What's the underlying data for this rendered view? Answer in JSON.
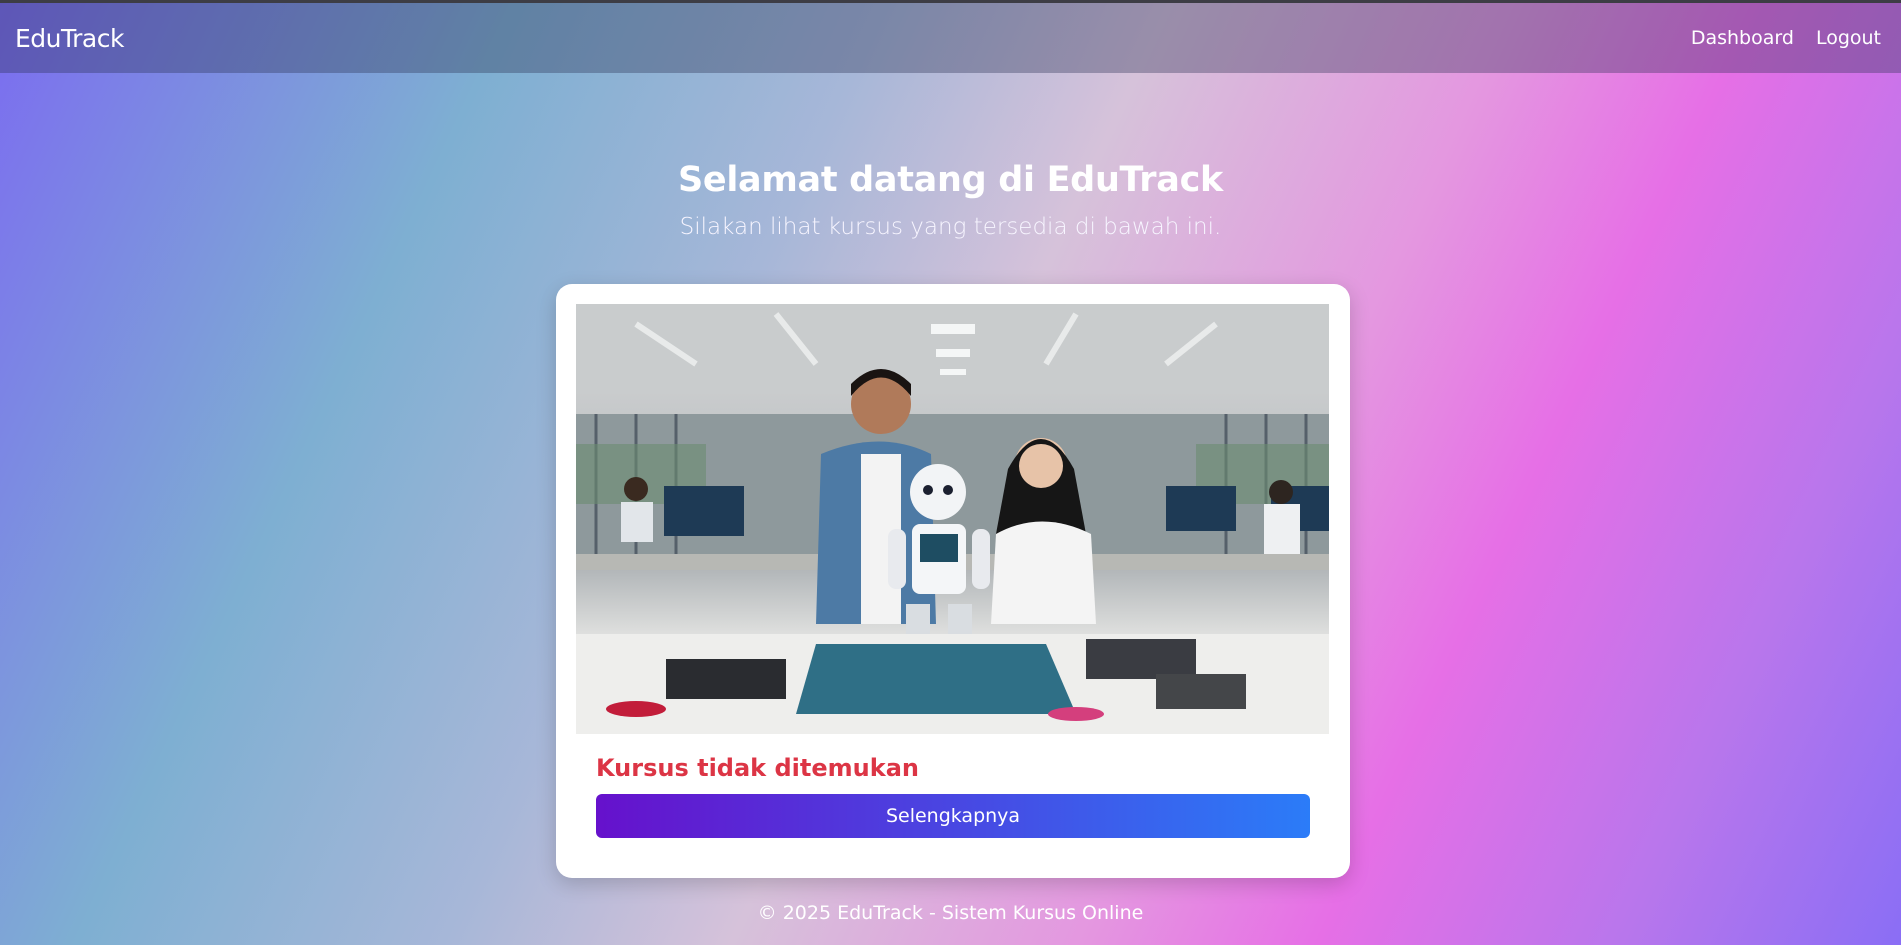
{
  "navbar": {
    "brand": "EduTrack",
    "links": [
      "Dashboard",
      "Logout"
    ]
  },
  "hero": {
    "title": "Selamat datang di EduTrack",
    "subtitle": "Silakan lihat kursus yang tersedia di bawah ini."
  },
  "course_card": {
    "image_name": "robotics-lab-photo",
    "title": "Kursus tidak ditemukan",
    "button_label": "Selengkapnya"
  },
  "footer": {
    "text": "© 2025 EduTrack - Sistem Kursus Online"
  },
  "colors": {
    "title_error": "#dc3545",
    "button_start": "#6611cc",
    "button_end": "#2b7cf8"
  }
}
